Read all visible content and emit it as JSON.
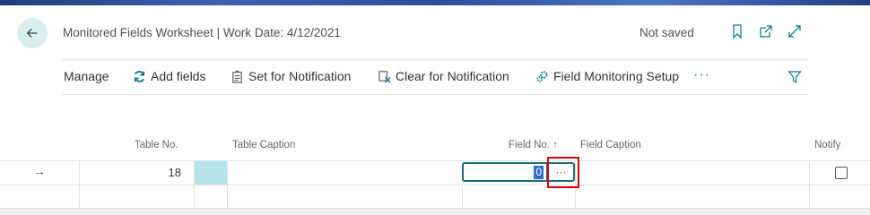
{
  "header": {
    "title": "Monitored Fields Worksheet | Work Date: 4/12/2021",
    "status": "Not saved"
  },
  "actions": [
    {
      "label": "Manage",
      "icon": "none"
    },
    {
      "label": "Add fields",
      "icon": "refresh-icon"
    },
    {
      "label": "Set for Notification",
      "icon": "notification-icon"
    },
    {
      "label": "Clear for Notification",
      "icon": "clear-notification-icon"
    },
    {
      "label": "Field Monitoring Setup",
      "icon": "setup-gear-icon"
    }
  ],
  "more_label": "···",
  "table": {
    "columns": [
      "Table No.",
      "Table Caption",
      "Field No. ↑",
      "Field Caption",
      "Notify"
    ],
    "rows": [
      {
        "table_no": "18",
        "table_caption": "",
        "field_no": "0",
        "field_caption": "",
        "notify": false
      }
    ],
    "lookup_label": "···"
  },
  "colors": {
    "accent": "#0a7f8e",
    "selection": "#2d6ed1",
    "highlight": "#e00000"
  }
}
